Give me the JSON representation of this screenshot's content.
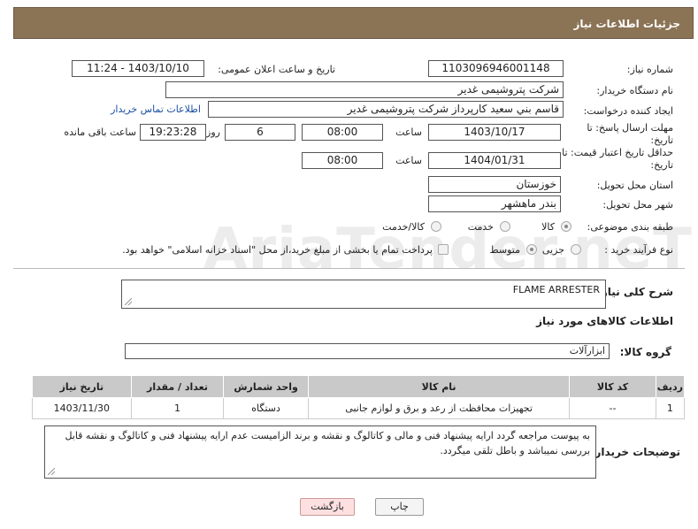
{
  "header": {
    "title": "جزئیات اطلاعات نیاز"
  },
  "fields": {
    "need_number_label": "شماره نیاز:",
    "need_number": "1103096946001148",
    "announce_label": "تاریخ و ساعت اعلان عمومی:",
    "announce_value": "1403/10/10 - 11:24",
    "buyer_org_label": "نام دستگاه خریدار:",
    "buyer_org": "شرکت پتروشیمی غدیر",
    "requester_label": "ایجاد کننده درخواست:",
    "requester": "قاسم بني سعيد کارپرداز شرکت پتروشیمی غدیر",
    "contact_link": "اطلاعات تماس خریدار",
    "reply_deadline_label": "مهلت ارسال پاسخ: تا تاریخ:",
    "reply_date": "1403/10/17",
    "time_label": "ساعت",
    "reply_time": "08:00",
    "days_value": "6",
    "days_label": "روز و",
    "remaining_time": "19:23:28",
    "remaining_label": "ساعت باقی مانده",
    "price_deadline_label": "حداقل تاریخ اعتبار قیمت: تا تاریخ:",
    "price_date": "1404/01/31",
    "price_time": "08:00",
    "province_label": "استان محل تحویل:",
    "province": "خوزستان",
    "city_label": "شهر محل تحویل:",
    "city": "بندر ماهشهر",
    "category_label": "طبقه بندی موضوعی:",
    "category_options": [
      "کالا",
      "خدمت",
      "کالا/خدمت"
    ],
    "process_label": "نوع فرآیند خرید :",
    "process_options": [
      "جزیی",
      "متوسط"
    ],
    "payment_note": "پرداخت تمام یا بخشی از مبلغ خرید،از محل \"اسناد خزانه اسلامی\" خواهد بود."
  },
  "need_desc": {
    "label": "شرح کلی نیاز:",
    "value": "FLAME ARRESTER"
  },
  "goods_info": {
    "title": "اطلاعات کالاهای مورد نیاز"
  },
  "goods_group": {
    "label": "گروه کالا:",
    "value": "ابزارآلات"
  },
  "table": {
    "headers": [
      "ردیف",
      "کد کالا",
      "نام کالا",
      "واحد شمارش",
      "تعداد / مقدار",
      "تاریخ نیاز"
    ],
    "rows": [
      [
        "1",
        "--",
        "تجهیزات محافظت از رعد و برق و لوازم جانبی",
        "دستگاه",
        "1",
        "1403/11/30"
      ]
    ]
  },
  "buyer_notes": {
    "label": "توضیحات خریدار:",
    "value": "به پیوست مراجعه گردد ارایه پیشنهاد فنی و مالی و کاتالوگ و نقشه و برند الزامیست عدم ارایه پیشنهاد فنی و کاتالوگ و نقشه قابل بررسی نمیباشد و باطل تلقی میگردد."
  },
  "buttons": {
    "print": "چاپ",
    "back": "بازگشت"
  },
  "watermark": "AriaTender.neT"
}
